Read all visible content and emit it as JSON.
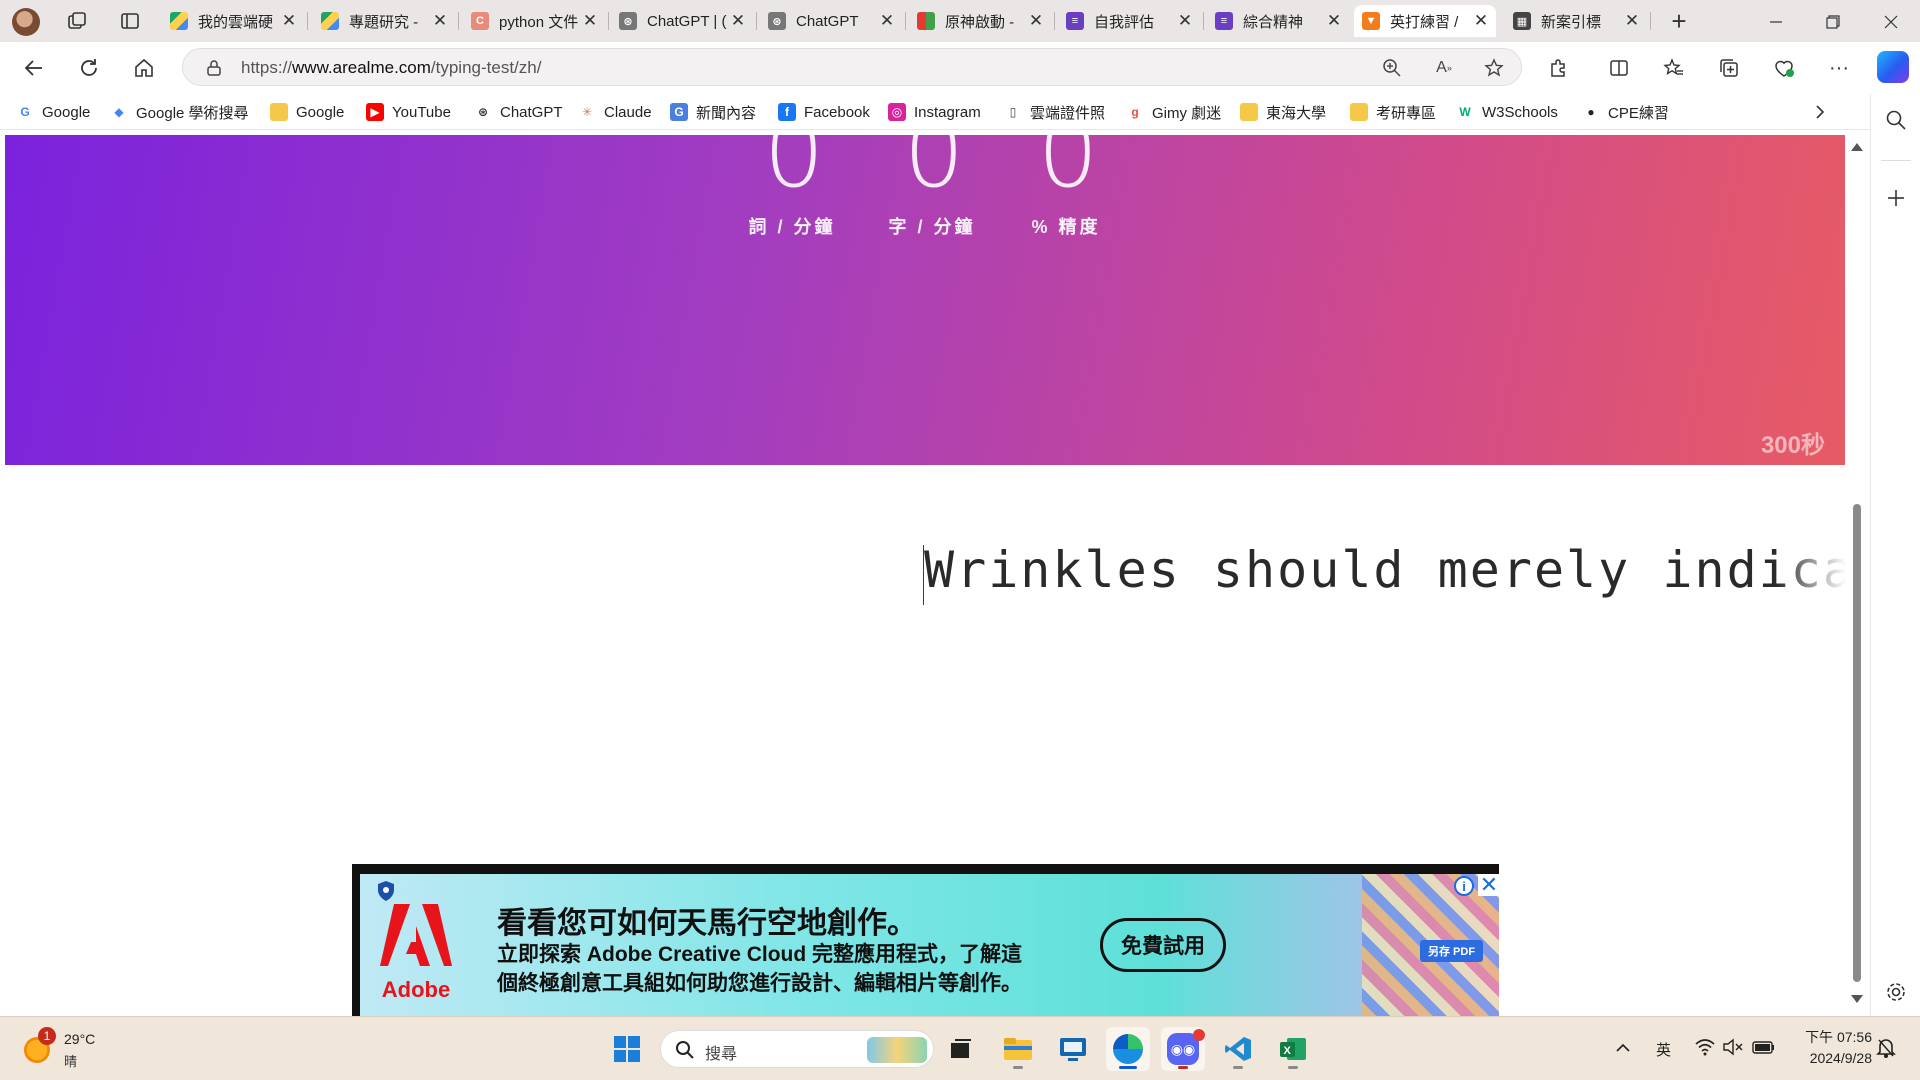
{
  "tabs": [
    {
      "title": "我的雲端硬",
      "active": false,
      "icon": "google-drive-icon"
    },
    {
      "title": "專題研究 -",
      "active": false,
      "icon": "google-drive-icon"
    },
    {
      "title": "python 文件",
      "active": false,
      "icon": "c-letter-icon"
    },
    {
      "title": "ChatGPT | (",
      "active": false,
      "icon": "chatgpt-icon"
    },
    {
      "title": "ChatGPT",
      "active": false,
      "icon": "chatgpt-icon"
    },
    {
      "title": "原神啟動 -",
      "active": false,
      "icon": "flag-icon"
    },
    {
      "title": "自我評估",
      "active": false,
      "icon": "forms-icon"
    },
    {
      "title": "綜合精神",
      "active": false,
      "icon": "forms-icon"
    },
    {
      "title": "英打練習 /",
      "active": true,
      "icon": "fox-icon"
    },
    {
      "title": "新案引標",
      "active": false,
      "icon": "calendar-icon"
    }
  ],
  "address": {
    "url_prefix": "https://",
    "url_host": "www.arealme.com",
    "url_path": "/typing-test/zh/"
  },
  "bookmarks": [
    {
      "label": "Google",
      "icon": "google-icon"
    },
    {
      "label": "Google 學術搜尋",
      "icon": "scholar-icon"
    },
    {
      "label": "Google",
      "icon": "folder-icon"
    },
    {
      "label": "YouTube",
      "icon": "youtube-icon"
    },
    {
      "label": "ChatGPT",
      "icon": "chatgpt-icon"
    },
    {
      "label": "Claude",
      "icon": "claude-icon"
    },
    {
      "label": "新聞內容",
      "icon": "news-icon"
    },
    {
      "label": "Facebook",
      "icon": "facebook-icon"
    },
    {
      "label": "Instagram",
      "icon": "instagram-icon"
    },
    {
      "label": "雲端證件照",
      "icon": "document-icon"
    },
    {
      "label": "Gimy 劇迷",
      "icon": "gimy-icon"
    },
    {
      "label": "東海大學",
      "icon": "folder-icon"
    },
    {
      "label": "考研專區",
      "icon": "folder-icon"
    },
    {
      "label": "W3Schools",
      "icon": "w3schools-icon"
    },
    {
      "label": "CPE練習",
      "icon": "github-icon"
    }
  ],
  "stats": [
    {
      "value": "0",
      "label": "詞 / 分鐘"
    },
    {
      "value": "0",
      "label": "字 / 分鐘"
    },
    {
      "value": "0",
      "label": "% 精度"
    }
  ],
  "timer": "300秒",
  "typing_text": "Wrinkles should merely indicate whe",
  "ad": {
    "brand": "Adobe",
    "title": "看看您可如何天馬行空地創作。",
    "body_line1": "立即探索 Adobe Creative Cloud 完整應用程式，了解這",
    "body_line2": "個終極創意工具組如何助您進行設計、編輯相片等創作。",
    "cta": "免費試用",
    "art_badge": "另存 PDF"
  },
  "taskbar": {
    "weather_temp": "29°C",
    "weather_desc": "晴",
    "weather_badge": "1",
    "search_placeholder": "搜尋",
    "ime": "英",
    "time": "下午 07:56",
    "date": "2024/9/28"
  },
  "colors": {
    "hero_start": "#7b22dd",
    "hero_end": "#e75b64",
    "taskbar": "#f1e6da",
    "accent": "#0a5bd3"
  }
}
